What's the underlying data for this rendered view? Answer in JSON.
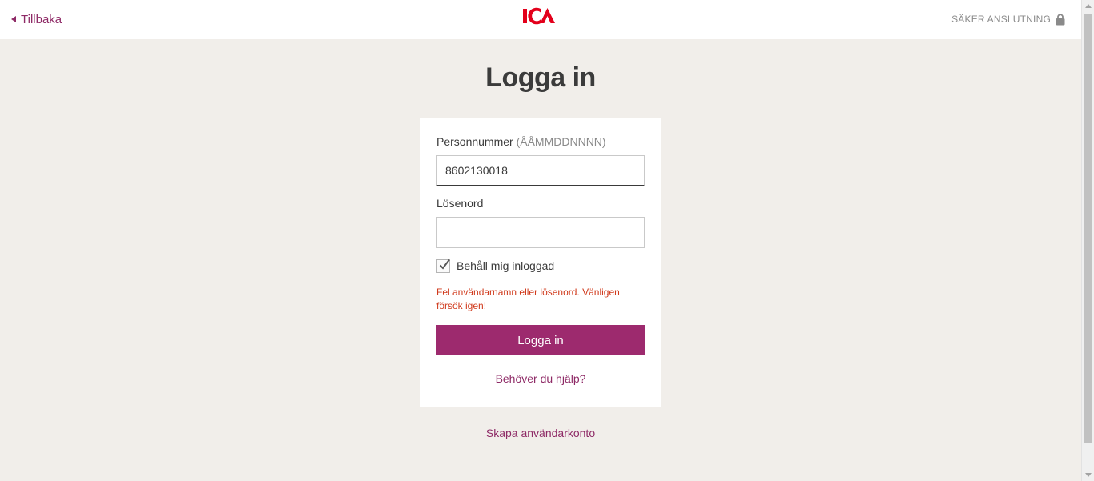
{
  "header": {
    "back_label": "Tillbaka",
    "logo_text": "ICA",
    "secure_label": "SÄKER ANSLUTNING"
  },
  "title": "Logga in",
  "form": {
    "personnummer_label": "Personnummer",
    "personnummer_hint": "(ÅÅMMDDNNNN)",
    "personnummer_value": "8602130018",
    "password_label": "Lösenord",
    "password_value": "",
    "remember_label": "Behåll mig inloggad",
    "remember_checked": true,
    "error_message": "Fel användarnamn eller lösenord. Vänligen försök igen!",
    "submit_label": "Logga in",
    "help_link": "Behöver du hjälp?"
  },
  "footer": {
    "create_account": "Skapa användarkonto"
  },
  "colors": {
    "brand": "#9d2a6e",
    "logo": "#e3001b",
    "error": "#d03a1c",
    "background": "#f1eeea"
  },
  "icons": [
    "back-caret-icon",
    "ica-logo",
    "lock-icon",
    "checkmark-icon"
  ]
}
